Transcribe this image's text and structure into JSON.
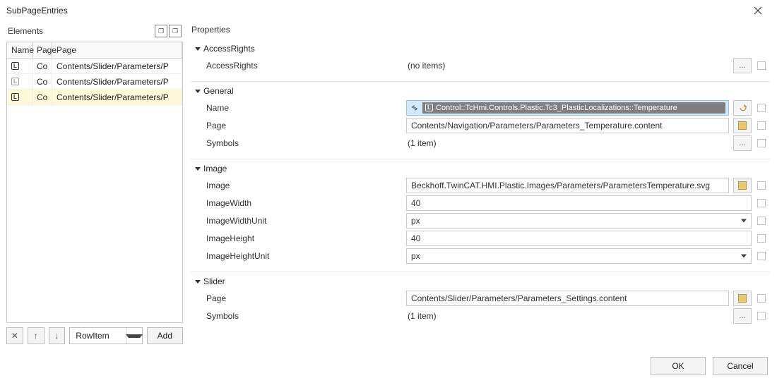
{
  "window": {
    "title": "SubPageEntries"
  },
  "leftPanel": {
    "label": "Elements",
    "headers": {
      "name": "Name",
      "page1": "Page",
      "page2": "Page"
    },
    "rows": [
      {
        "col1": "Co",
        "col2": "Contents/Slider/Parameters/P",
        "selected": false,
        "hollow": false
      },
      {
        "col1": "Co",
        "col2": "Contents/Slider/Parameters/P",
        "selected": false,
        "hollow": true
      },
      {
        "col1": "Co",
        "col2": "Contents/Slider/Parameters/P",
        "selected": true,
        "hollow": false
      }
    ],
    "toolbar": {
      "remove": "✕",
      "up": "↑",
      "down": "↓",
      "combo": "RowItem",
      "add": "Add"
    }
  },
  "rightPanel": {
    "label": "Properties",
    "ellipsis": "...",
    "groups": {
      "access": {
        "title": "AccessRights",
        "rows": {
          "accessRights": {
            "label": "AccessRights",
            "value": "(no items)"
          }
        }
      },
      "general": {
        "title": "General",
        "rows": {
          "name": {
            "label": "Name",
            "value": "Control::TcHmi.Controls.Plastic.Tc3_PlasticLocalizations::Temperature"
          },
          "page": {
            "label": "Page",
            "value": "Contents/Navigation/Parameters/Parameters_Temperature.content"
          },
          "symbols": {
            "label": "Symbols",
            "value": "(1 item)"
          }
        }
      },
      "image": {
        "title": "Image",
        "rows": {
          "image": {
            "label": "Image",
            "value": "Beckhoff.TwinCAT.HMI.Plastic.Images/Parameters/ParametersTemperature.svg"
          },
          "imageWidth": {
            "label": "ImageWidth",
            "value": "40"
          },
          "imageWidthUnit": {
            "label": "ImageWidthUnit",
            "value": "px"
          },
          "imageHeight": {
            "label": "ImageHeight",
            "value": "40"
          },
          "imageHeightUnit": {
            "label": "ImageHeightUnit",
            "value": "px"
          }
        }
      },
      "slider": {
        "title": "Slider",
        "rows": {
          "page": {
            "label": "Page",
            "value": "Contents/Slider/Parameters/Parameters_Settings.content"
          },
          "symbols": {
            "label": "Symbols",
            "value": "(1 item)"
          }
        }
      }
    }
  },
  "footer": {
    "ok": "OK",
    "cancel": "Cancel"
  }
}
